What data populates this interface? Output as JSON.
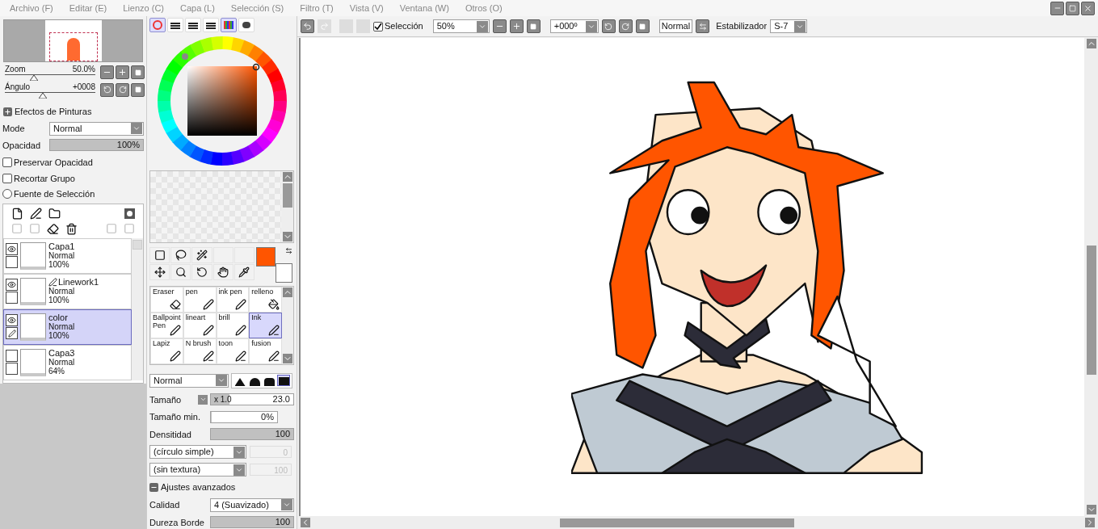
{
  "menu": [
    "Archivo (F)",
    "Editar (E)",
    "Lienzo (C)",
    "Capa (L)",
    "Selección (S)",
    "Filtro (T)",
    "Vista (V)",
    "Ventana (W)",
    "Otros (O)"
  ],
  "navigator": {
    "zoom": {
      "label": "Zoom",
      "value": "50.0%",
      "level": 0.32
    },
    "angle": {
      "label": "Ángulo",
      "value": "+0008",
      "level": 0.42
    }
  },
  "paint_effects": {
    "title": "Efectos de Pinturas",
    "expanded": false,
    "mode_label": "Mode",
    "mode": "Normal",
    "opacity_label": "Opacidad",
    "opacity": "100%",
    "opacity_bar": {
      "level": 1.0
    },
    "options": [
      {
        "kind": "checkbox",
        "label": "Preservar Opacidad",
        "checked": false
      },
      {
        "kind": "checkbox",
        "label": "Recortar Grupo",
        "checked": false
      },
      {
        "kind": "radio",
        "label": "Fuente de Selección",
        "checked": false
      }
    ]
  },
  "layers": [
    {
      "name": "Capa1",
      "mode": "Normal",
      "opacity": "100%",
      "visible": true,
      "linework": false,
      "editing": false,
      "selected": false
    },
    {
      "name": "Linework1",
      "mode": "Normal",
      "opacity": "100%",
      "visible": true,
      "linework": true,
      "editing": false,
      "selected": false
    },
    {
      "name": "color",
      "mode": "Normal",
      "opacity": "100%",
      "visible": true,
      "linework": false,
      "editing": true,
      "selected": true
    },
    {
      "name": "Capa3",
      "mode": "Normal",
      "opacity": "64%",
      "visible": false,
      "linework": false,
      "editing": false,
      "selected": false
    }
  ],
  "color_tabs": [
    {
      "selected": true
    },
    {
      "selected": false
    },
    {
      "selected": false
    },
    {
      "selected": false
    },
    {
      "selected": true
    },
    {
      "selected": false
    }
  ],
  "swatches": [
    {
      "kind": "foreground",
      "color": "#ff5500"
    },
    {
      "kind": "background",
      "color": "#ffffff"
    }
  ],
  "brushes": [
    {
      "name": "Eraser",
      "selected": false
    },
    {
      "name": "pen",
      "selected": false
    },
    {
      "name": "ink pen",
      "selected": false
    },
    {
      "name": "relleno",
      "selected": false
    },
    {
      "name": "Ballpoint Pen",
      "selected": false
    },
    {
      "name": "lineart",
      "selected": false
    },
    {
      "name": "brill",
      "selected": false
    },
    {
      "name": "Ink",
      "selected": true
    },
    {
      "name": "Lapiz",
      "selected": false
    },
    {
      "name": "N brush",
      "selected": false
    },
    {
      "name": "toon",
      "selected": false
    },
    {
      "name": "fusion",
      "selected": false
    }
  ],
  "brush_settings": {
    "blend": "Normal",
    "shapes": [
      {
        "selected": false
      },
      {
        "selected": false
      },
      {
        "selected": false
      },
      {
        "selected": true
      }
    ],
    "size_label": "Tamaño",
    "size_multiplier": "x 1.0",
    "size": "23.0",
    "size_bar": {
      "level": 0.23
    },
    "min_size_label": "Tamaño min.",
    "min_size": "0%",
    "min_size_bar": {
      "level": 0
    },
    "density_label": "Densitidad",
    "density": "100",
    "density_bar": {
      "level": 1.0
    },
    "shape": "(círculo simple)",
    "shape_value": "0",
    "texture": "(sin textura)",
    "texture_value": "100",
    "advanced_label": "Ajustes avanzados",
    "advanced_expanded": true,
    "quality_label": "Calidad",
    "quality": "4 (Suavizado)",
    "hardness_label": "Dureza Borde",
    "hardness": "100",
    "hardness_bar": {
      "level": 1.0
    }
  },
  "toolbar": {
    "selection_label": "Selección",
    "selection_checked": true,
    "zoom": "50%",
    "angle": "+000º",
    "blend": "Normal",
    "stabilizer_label": "Estabilizador",
    "stabilizer": "S-7"
  }
}
